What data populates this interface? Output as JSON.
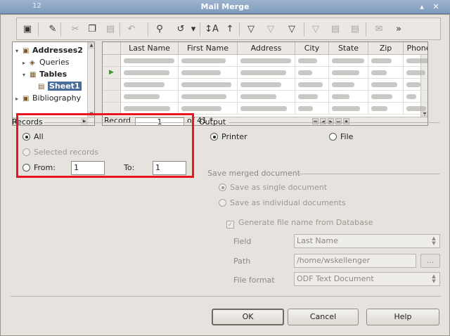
{
  "window": {
    "title": "Mail Merge",
    "background_menu_fragment": [
      "12",
      "Mail Merge"
    ],
    "buttons": [
      "▴",
      "✕"
    ]
  },
  "toolbar": {
    "icons": [
      "save-icon",
      "edit-icon",
      "cut-icon",
      "copy-icon",
      "paste-icon",
      "undo-arrow-icon",
      "find-icon",
      "undo-icon",
      "redo-dropdown-icon",
      "sort-ascending-icon",
      "sort-descending-icon",
      "autofilter-icon",
      "standard-filter-icon",
      "apply-filter-icon",
      "remove-filter-icon",
      "data-to-text-icon",
      "data-to-fields-icon",
      "mail-merge-icon",
      "more-icon"
    ],
    "glyphs": [
      "▣",
      "✎",
      "✂",
      "❐",
      "▤",
      "↶",
      "⚲",
      "↺",
      "▾",
      "↕A",
      "↑",
      "▽",
      "▽",
      "▽",
      "▽",
      "▤",
      "▤",
      "✉",
      "»"
    ]
  },
  "tree": {
    "items": [
      {
        "label": "Addresses2",
        "expander": "▾",
        "icon": "▣",
        "bold": true
      },
      {
        "label": "Queries",
        "expander": "▸",
        "icon": "◈",
        "bold": false
      },
      {
        "label": "Tables",
        "expander": "▾",
        "icon": "▦",
        "bold": true
      },
      {
        "label": "Sheet1",
        "expander": "",
        "icon": "▤",
        "bold": true,
        "selected": true
      },
      {
        "label": "Bibliography",
        "expander": "▸",
        "icon": "▣",
        "bold": false
      }
    ]
  },
  "grid": {
    "columns": [
      "Last Name",
      "First Name",
      "Address",
      "City",
      "State",
      "Zip",
      "Phone"
    ],
    "current_row_marker": "▶",
    "navigator": {
      "record_label": "Record",
      "record_value": "1",
      "of_label": "of 41 *"
    }
  },
  "records": {
    "label": "Records",
    "all_label": "All",
    "selected_label": "Selected records",
    "from_label": "From:",
    "from_value": "1",
    "to_label": "To:",
    "to_value": "1",
    "selected_option": "all"
  },
  "output": {
    "label": "Output",
    "printer_label": "Printer",
    "file_label": "File",
    "selected_option": "printer"
  },
  "save_merged": {
    "label": "Save merged document",
    "single_label": "Save as single document",
    "individual_label": "Save as individual documents",
    "generate_label": "Generate file name from Database",
    "field_label": "Field",
    "field_value": "Last Name",
    "path_label": "Path",
    "path_value": "/home/wskellenger",
    "browse_label": "...",
    "format_label": "File format",
    "format_value": "ODF Text Document"
  },
  "buttons": {
    "ok": "OK",
    "cancel": "Cancel",
    "help": "Help"
  },
  "colors": {
    "highlight": "#e8141e",
    "titlebar": "#8aa6c6",
    "dialog_bg": "#e6e3df"
  }
}
